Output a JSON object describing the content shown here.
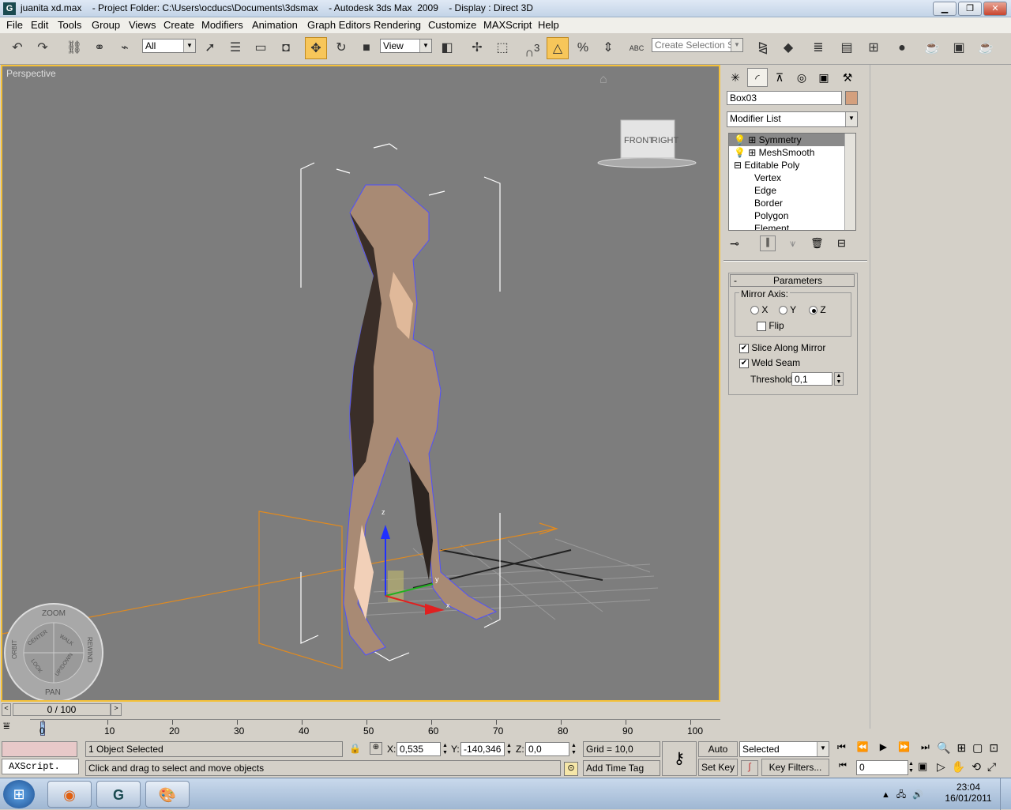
{
  "window": {
    "title": "juanita xd.max    - Project Folder: C:\\Users\\ocducs\\Documents\\3dsmax    - Autodesk 3ds Max  2009    - Display : Direct 3D",
    "app_icon": "3ds-max-icon",
    "buttons": {
      "minimize": "▁",
      "restore": "❐",
      "close": "✕"
    }
  },
  "menu": [
    "File",
    "Edit",
    "Tools",
    "Group",
    "Views",
    "Create",
    "Modifiers",
    "Animation",
    "Graph Editors",
    "Rendering",
    "Customize",
    "MAXScript",
    "Help"
  ],
  "toolbar": {
    "selection_filter": "All",
    "reference_coord": "View",
    "named_selection_placeholder": "Create Selection Set",
    "snap_label": "3",
    "abc_label": "ABC"
  },
  "viewport": {
    "label": "Perspective",
    "viewcube": {
      "front": "FRONT",
      "right": "RIGHT"
    },
    "steering_wheel": {
      "zoom": "ZOOM",
      "orbit": "ORBIT",
      "center": "CENTER",
      "walk": "WALK",
      "rewind": "REWIND",
      "look": "LOOK",
      "updown": "UP/DOWN",
      "pan": "PAN"
    },
    "gizmo_axes": {
      "x": "x",
      "y": "y",
      "z": "z"
    }
  },
  "command_panel": {
    "object_name": "Box03",
    "object_color": "#d4a07e",
    "modifier_list_label": "Modifier List",
    "stack": [
      "Symmetry",
      "MeshSmooth",
      "Editable Poly",
      "Vertex",
      "Edge",
      "Border",
      "Polygon",
      "Element"
    ],
    "rollout_title": "Parameters",
    "collapse_symbol": "-",
    "mirror_axis_label": "Mirror Axis:",
    "axis_options": [
      "X",
      "Y",
      "Z"
    ],
    "selected_axis": "Z",
    "flip_label": "Flip",
    "flip_checked": false,
    "slice_label": "Slice Along Mirror",
    "slice_checked": true,
    "weld_label": "Weld Seam",
    "weld_checked": true,
    "threshold_label": "Threshold:",
    "threshold_value": "0,1"
  },
  "timeline": {
    "frame_display": "0 / 100",
    "ticks": [
      "0",
      "10",
      "20",
      "30",
      "40",
      "50",
      "60",
      "70",
      "80",
      "90",
      "100"
    ],
    "current_frame_fraction": 0
  },
  "status": {
    "selection": "1 Object Selected",
    "prompt": "Click and drag to select and move objects",
    "maxscript": "AXScript.",
    "x_label": "X:",
    "x_value": "0,535",
    "y_label": "Y:",
    "y_value": "-140,346",
    "z_label": "Z:",
    "z_value": "0,0",
    "grid": "Grid = 10,0",
    "add_time_tag": "Add Time Tag",
    "auto_key": "Auto Key",
    "set_key": "Set Key",
    "key_mode": "Selected",
    "key_filters": "Key Filters...",
    "current_frame": "0"
  },
  "taskbar": {
    "time": "23:04",
    "date": "16/01/2011"
  }
}
